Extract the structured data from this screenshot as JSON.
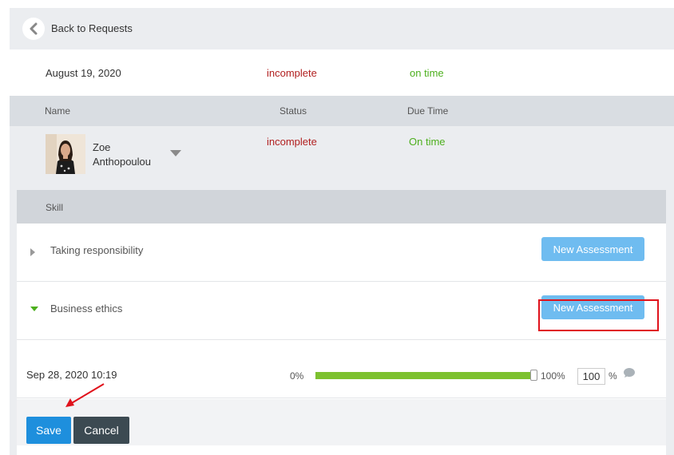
{
  "nav": {
    "back_label": "Back to Requests"
  },
  "summary": {
    "date": "August 19, 2020",
    "status": "incomplete",
    "due": "on time"
  },
  "table_headers": {
    "name": "Name",
    "status": "Status",
    "due_time": "Due Time"
  },
  "person": {
    "first_name": "Zoe",
    "last_name": "Anthopoulou",
    "status": "incomplete",
    "due": "On time"
  },
  "skills": {
    "header": "Skill",
    "rows": [
      {
        "name": "Taking responsibility",
        "expanded": false,
        "button_label": "New Assessment"
      },
      {
        "name": "Business ethics",
        "expanded": true,
        "button_label": "New Assessment"
      }
    ]
  },
  "assessment": {
    "date": "Sep 28, 2020 10:19",
    "min_label": "0%",
    "max_label": "100%",
    "value": "100",
    "percent_sign": "%",
    "progress": 1.0
  },
  "actions": {
    "save_label": "Save",
    "cancel_label": "Cancel"
  },
  "colors": {
    "incomplete": "#b11f1f",
    "on_time": "#4caf1d",
    "primary_button": "#1e8fdd",
    "secondary_button": "#3c4a52",
    "assessment_button": "#6fbcf0",
    "highlight": "#e0121c",
    "progress_fill": "#7dc12f"
  },
  "icons": {
    "back": "chevron-left-icon",
    "person_caret": "caret-down-icon",
    "collapsed": "caret-right-icon",
    "expanded": "caret-down-icon",
    "comment": "comment-icon"
  }
}
